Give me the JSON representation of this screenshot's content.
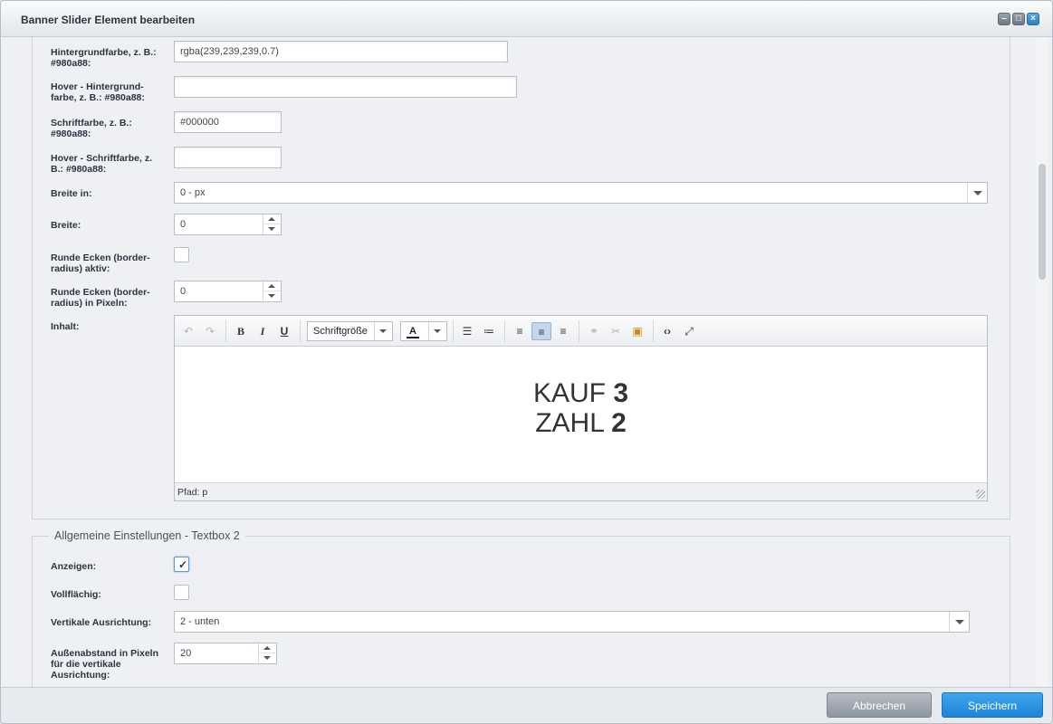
{
  "window": {
    "title": "Banner Slider Element bearbeiten"
  },
  "form1": {
    "bg_color_label": "Hintergrundfarbe, z. B.: #980a88:",
    "bg_color_value": "rgba(239,239,239,0.7)",
    "hover_bg_label": "Hover - Hintergrund-farbe, z. B.: #980a88:",
    "hover_bg_value": "",
    "font_color_label": "Schriftfarbe, z. B.: #980a88:",
    "font_color_value": "#000000",
    "hover_font_label": "Hover - Schriftfarbe, z. B.: #980a88:",
    "hover_font_value": "",
    "width_in_label": "Breite in:",
    "width_in_value": "0 - px",
    "width_label": "Breite:",
    "width_value": "0",
    "rounded_active_label": "Runde Ecken (border-radius) aktiv:",
    "rounded_px_label": "Runde Ecken (border-radius) in Pixeln:",
    "rounded_px_value": "0",
    "content_label": "Inhalt:"
  },
  "editor": {
    "font_size_select": "Schriftgröße",
    "line1_text": "KAUF ",
    "line1_bold": "3",
    "line2_text": "ZAHL ",
    "line2_bold": "2",
    "path": "Pfad: p",
    "toolbar_icons": [
      "undo-icon",
      "redo-icon",
      "bold-icon",
      "italic-icon",
      "underline-icon",
      "font-size-select",
      "text-color-icon",
      "bullet-list-icon",
      "numbered-list-icon",
      "align-left-icon",
      "align-center-icon",
      "align-right-icon",
      "link-icon",
      "unlink-icon",
      "image-icon",
      "code-icon",
      "fullscreen-icon"
    ]
  },
  "form2": {
    "legend": "Allgemeine Einstellungen - Textbox 2",
    "show_label": "Anzeigen:",
    "show_checked": true,
    "full_label": "Vollflächig:",
    "full_checked": false,
    "valign_label": "Vertikale Ausrichtung:",
    "valign_value": "2 - unten",
    "margin_label": "Außenabstand in Pixeln für die vertikale Ausrichtung:",
    "margin_value": "20"
  },
  "footer": {
    "cancel_label": "Abbrechen",
    "save_label": "Speichern"
  },
  "colors": {
    "save_button": "#2a92e2",
    "cancel_button": "#9ea6af",
    "close_button": "#3b8fd3"
  }
}
